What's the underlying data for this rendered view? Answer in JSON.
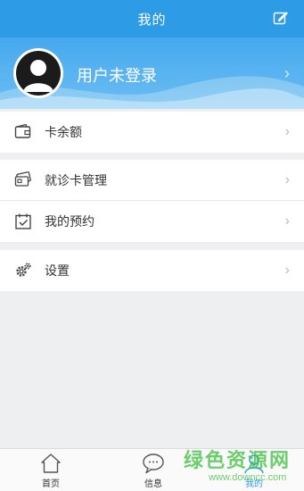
{
  "header": {
    "title": "我的",
    "edit_icon": "edit-icon"
  },
  "profile": {
    "name": "用户未登录",
    "chevron": "›"
  },
  "sections": [
    {
      "items": [
        {
          "label": "卡余额",
          "icon": "wallet-icon",
          "chevron": "›"
        }
      ]
    },
    {
      "items": [
        {
          "label": "就诊卡管理",
          "icon": "cards-icon",
          "chevron": "›"
        },
        {
          "label": "我的预约",
          "icon": "calendar-check-icon",
          "chevron": "›"
        }
      ]
    },
    {
      "items": [
        {
          "label": "设置",
          "icon": "gear-icon",
          "chevron": "›"
        }
      ]
    }
  ],
  "tabbar": {
    "tabs": [
      {
        "label": "首页",
        "icon": "home-icon",
        "active": false
      },
      {
        "label": "信息",
        "icon": "chat-bubble-icon",
        "active": false
      },
      {
        "label": "我的",
        "icon": "person-icon",
        "active": true
      }
    ]
  },
  "watermark": {
    "main": "绿色资源网",
    "sub": "www.downcc.com"
  },
  "colors": {
    "accent": "#2e9be6",
    "background": "#eeeff1",
    "watermark": "#3cbe3c"
  }
}
